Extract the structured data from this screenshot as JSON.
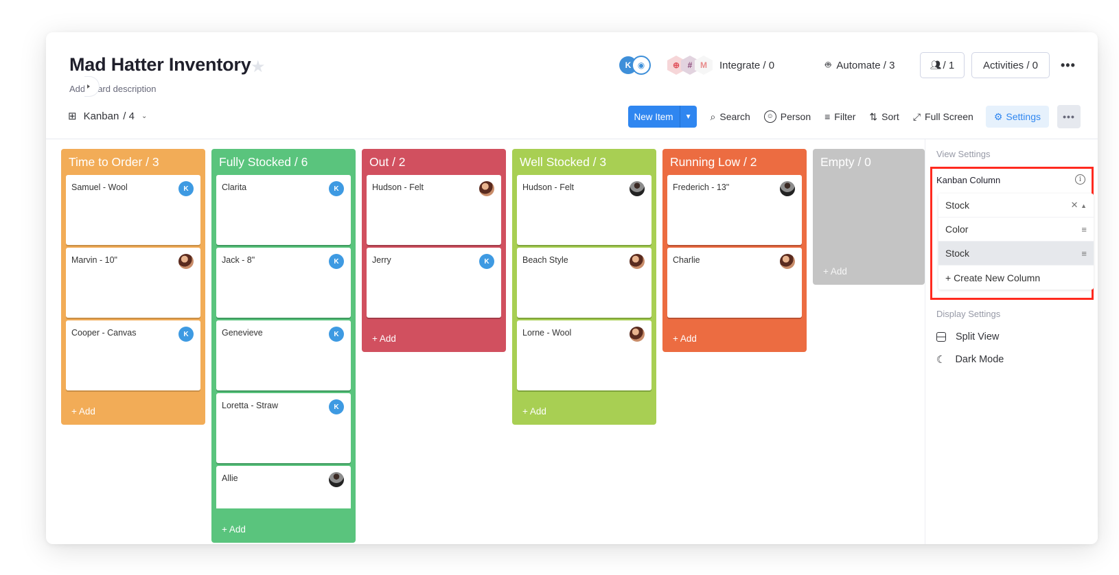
{
  "board": {
    "title": "Mad Hatter Inventory",
    "description": "Add board description",
    "favorite_icon": "star-icon"
  },
  "header": {
    "owner_avatar": "K",
    "integrate_label": "Integrate / 0",
    "automate_label": "Automate / 3",
    "members_label": "/ 1",
    "activities_label": "Activities / 0",
    "more_label": "•••",
    "integration_icons": [
      "twilio-icon",
      "slack-icon",
      "gmail-icon"
    ]
  },
  "toolbar": {
    "view_label": "Kanban",
    "view_count": "/ 4",
    "new_item_label": "New Item",
    "search_label": "Search",
    "person_label": "Person",
    "filter_label": "Filter",
    "sort_label": "Sort",
    "fullscreen_label": "Full Screen",
    "settings_label": "Settings",
    "more_label": "•••"
  },
  "columns": [
    {
      "title": "Time to Order / 3",
      "color": "#f2ac57",
      "shade": "#c98f46",
      "add_label": "+ Add",
      "cards": [
        {
          "name": "Samuel - Wool",
          "avatar": "K"
        },
        {
          "name": "Marvin - 10\"",
          "avatar": "p1"
        },
        {
          "name": "Cooper - Canvas",
          "avatar": "K"
        }
      ]
    },
    {
      "title": "Fully Stocked / 6",
      "color": "#5ac47d",
      "shade": "#3e9a5e",
      "add_label": "+ Add",
      "cards": [
        {
          "name": "Clarita",
          "avatar": "K"
        },
        {
          "name": "Jack - 8\"",
          "avatar": "K"
        },
        {
          "name": "Genevieve",
          "avatar": "K"
        },
        {
          "name": "Loretta - Straw",
          "avatar": "K"
        },
        {
          "name": "Allie",
          "avatar": "p2"
        }
      ]
    },
    {
      "title": "Out / 2",
      "color": "#d1505f",
      "shade": "#a33c48",
      "add_label": "+ Add",
      "cards": [
        {
          "name": "Hudson - Felt",
          "avatar": "p1"
        },
        {
          "name": "Jerry",
          "avatar": "K"
        }
      ]
    },
    {
      "title": "Well Stocked / 3",
      "color": "#a8cf53",
      "shade": "#7fa43c",
      "add_label": "+ Add",
      "cards": [
        {
          "name": "Hudson - Felt",
          "avatar": "p2"
        },
        {
          "name": "Beach Style",
          "avatar": "p1"
        },
        {
          "name": "Lorne - Wool",
          "avatar": "p1"
        }
      ]
    },
    {
      "title": "Running Low / 2",
      "color": "#ec6c41",
      "shade": "#bb5232",
      "add_label": "+ Add",
      "cards": [
        {
          "name": "Frederich - 13\"",
          "avatar": "p2"
        },
        {
          "name": "Charlie",
          "avatar": "p1"
        }
      ]
    },
    {
      "title": "Empty / 0",
      "color": "#c4c4c4",
      "shade": "#aaaaaa",
      "add_label": "+ Add",
      "cards": []
    }
  ],
  "settings_panel": {
    "view_settings_label": "View Settings",
    "kanban_column_label": "Kanban Column",
    "selected_value": "Stock",
    "options": [
      "Color",
      "Stock"
    ],
    "highlighted_option": "Stock",
    "create_label": "+ Create New Column",
    "display_settings_label": "Display Settings",
    "split_view_label": "Split View",
    "dark_mode_label": "Dark Mode",
    "highlight_color": "#ff2a1f"
  }
}
